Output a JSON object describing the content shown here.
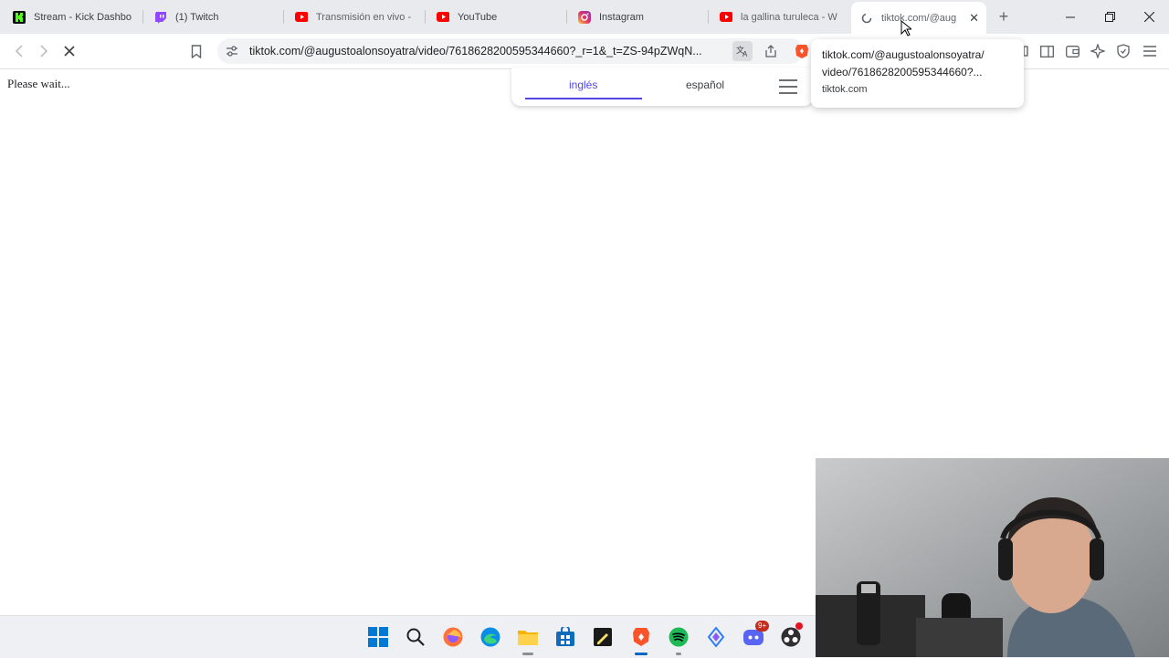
{
  "tabs": [
    {
      "title": "Stream - Kick Dashbo",
      "icon": "kick-icon"
    },
    {
      "title": "(1) Twitch",
      "icon": "twitch-icon"
    },
    {
      "title": "Transmisión en vivo -",
      "icon": "youtube-icon"
    },
    {
      "title": "YouTube",
      "icon": "youtube-icon"
    },
    {
      "title": "Instagram",
      "icon": "instagram-icon"
    },
    {
      "title": "la gallina turuleca - W",
      "icon": "youtube-icon"
    },
    {
      "title": "tiktok.com/@aug",
      "icon": "loading-icon",
      "active": true
    }
  ],
  "address_bar": {
    "url": "tiktok.com/@augustoalonsoyatra/video/7618628200595344660?_r=1&_t=ZS-94pZWqN..."
  },
  "tab_hover_card": {
    "title": "tiktok.com/@augustoalonsoyatra/video/7618628200595344660?...",
    "title_line1": "tiktok.com/@augustoalonsoyatra/",
    "title_line2": "video/7618628200595344660?...",
    "domain": "tiktok.com"
  },
  "translate_bar": {
    "source_language": "inglés",
    "target_language": "español"
  },
  "page": {
    "status_text": "Please wait..."
  },
  "taskbar": {
    "icons": [
      "windows-start-icon",
      "search-icon",
      "firefox-icon",
      "edge-icon",
      "file-explorer-icon",
      "store-icon",
      "sticky-notes-icon",
      "brave-icon",
      "spotify-icon",
      "app-icon",
      "discord-icon",
      "obs-icon"
    ],
    "discord_badge": "9+"
  },
  "colors": {
    "accent": "#4f46e5",
    "kick": "#53fc18",
    "twitch": "#9146ff",
    "youtube": "#ff0000",
    "brave": "#fb542b",
    "spotify": "#1db954"
  }
}
